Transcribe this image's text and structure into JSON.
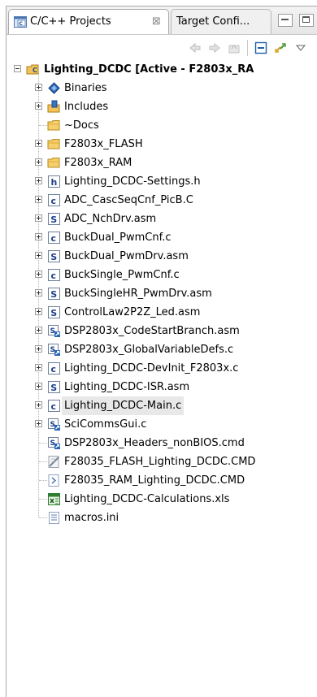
{
  "tabs": {
    "active_label": "C/C++ Projects",
    "close_glyph": "⊠",
    "inactive_label": "Target Confi..."
  },
  "project": {
    "name": "Lighting_DCDC",
    "status": "[Active - F2803x_RA"
  },
  "items": [
    {
      "label": "Binaries",
      "icon": "binaries-icon",
      "expander": "plus"
    },
    {
      "label": "Includes",
      "icon": "includes-icon",
      "expander": "plus"
    },
    {
      "label": "~Docs",
      "icon": "folder-icon",
      "expander": "none"
    },
    {
      "label": "F2803x_FLASH",
      "icon": "folder-icon",
      "expander": "plus"
    },
    {
      "label": "F2803x_RAM",
      "icon": "folder-icon",
      "expander": "plus"
    },
    {
      "label": "Lighting_DCDC-Settings.h",
      "icon": "h-file-icon",
      "expander": "plus"
    },
    {
      "label": "ADC_CascSeqCnf_PicB.C",
      "icon": "c-file-icon",
      "expander": "plus"
    },
    {
      "label": "ADC_NchDrv.asm",
      "icon": "asm-file-icon",
      "expander": "plus"
    },
    {
      "label": "BuckDual_PwmCnf.c",
      "icon": "c-file-icon",
      "expander": "plus"
    },
    {
      "label": "BuckDual_PwmDrv.asm",
      "icon": "asm-file-icon",
      "expander": "plus"
    },
    {
      "label": "BuckSingle_PwmCnf.c",
      "icon": "c-file-icon",
      "expander": "plus"
    },
    {
      "label": "BuckSingleHR_PwmDrv.asm",
      "icon": "asm-file-icon",
      "expander": "plus"
    },
    {
      "label": "ControlLaw2P2Z_Led.asm",
      "icon": "asm-file-icon",
      "expander": "plus"
    },
    {
      "label": "DSP2803x_CodeStartBranch.asm",
      "icon": "linked-file-icon",
      "expander": "plus"
    },
    {
      "label": "DSP2803x_GlobalVariableDefs.c",
      "icon": "linked-file-icon",
      "expander": "plus"
    },
    {
      "label": "Lighting_DCDC-DevInit_F2803x.c",
      "icon": "c-file-icon",
      "expander": "plus"
    },
    {
      "label": "Lighting_DCDC-ISR.asm",
      "icon": "asm-file-icon",
      "expander": "plus"
    },
    {
      "label": "Lighting_DCDC-Main.c",
      "icon": "c-file-icon",
      "expander": "plus",
      "selected": true
    },
    {
      "label": "SciCommsGui.c",
      "icon": "linked-file-icon",
      "expander": "plus"
    },
    {
      "label": "DSP2803x_Headers_nonBIOS.cmd",
      "icon": "linked-file-icon",
      "expander": "none"
    },
    {
      "label": "F28035_FLASH_Lighting_DCDC.CMD",
      "icon": "cmd-excluded-icon",
      "expander": "none"
    },
    {
      "label": "F28035_RAM_Lighting_DCDC.CMD",
      "icon": "cmd-file-icon",
      "expander": "none"
    },
    {
      "label": "Lighting_DCDC-Calculations.xls",
      "icon": "xls-file-icon",
      "expander": "none"
    },
    {
      "label": "macros.ini",
      "icon": "text-file-icon",
      "expander": "none"
    }
  ]
}
